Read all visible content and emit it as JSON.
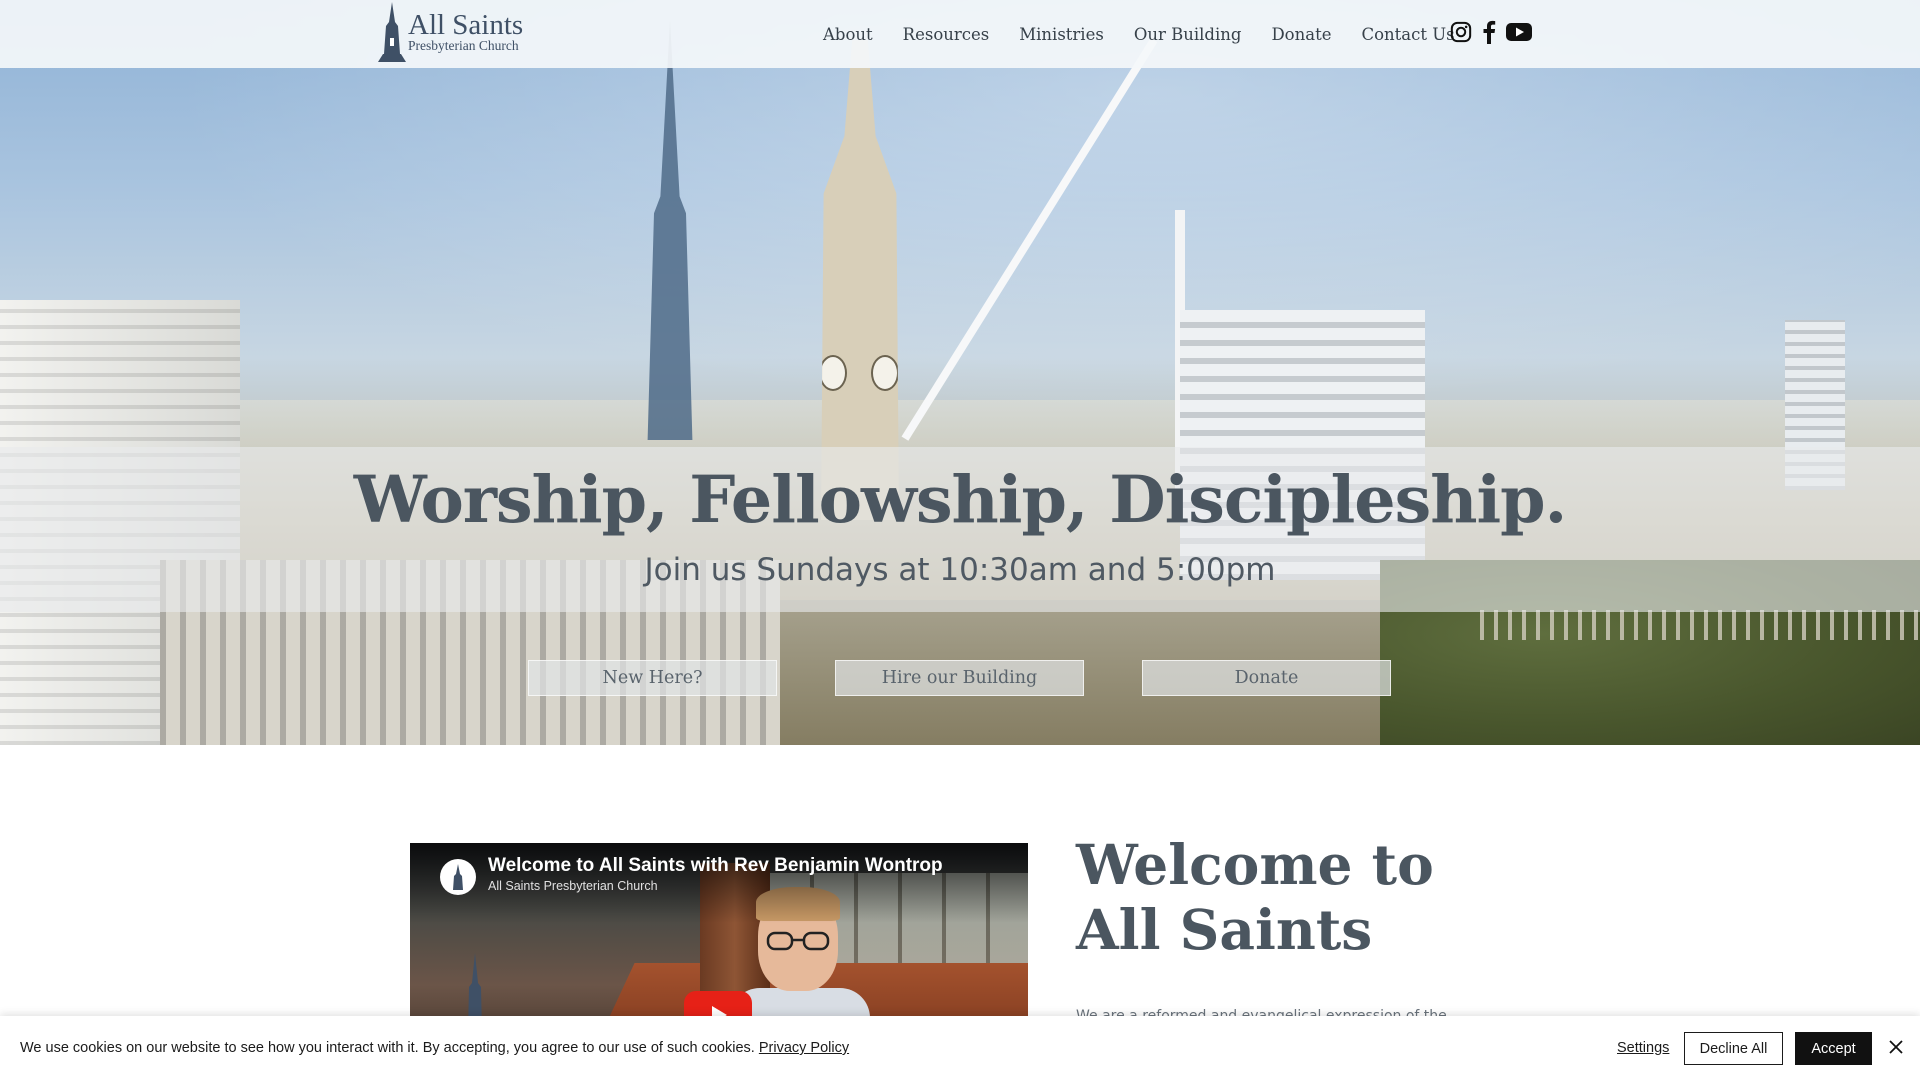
{
  "site": {
    "logo_title": "All Saints",
    "logo_subtitle": "Presbyterian Church"
  },
  "nav": {
    "items": [
      {
        "label": "About"
      },
      {
        "label": "Resources"
      },
      {
        "label": "Ministries"
      },
      {
        "label": "Our Building"
      },
      {
        "label": "Donate"
      },
      {
        "label": "Contact Us"
      }
    ]
  },
  "social": {
    "icons": [
      "instagram-icon",
      "facebook-icon",
      "youtube-icon"
    ]
  },
  "hero": {
    "title": "Worship, Fellowship, Discipleship.",
    "subtitle": "Join us Sundays at 10:30am and 5:00pm",
    "buttons": [
      {
        "label": "New Here?"
      },
      {
        "label": "Hire our Building"
      },
      {
        "label": "Donate"
      }
    ]
  },
  "video": {
    "title": "Welcome to All Saints with Rev Benjamin Wontrop",
    "channel": "All Saints Presbyterian Church"
  },
  "welcome": {
    "title_line1": "Welcome to",
    "title_line2": "All Saints",
    "body": "We are a reformed and evangelical expression of the"
  },
  "cookie": {
    "text": "We use cookies on our website to see how you interact with it. By accepting, you agree to our use of such cookies.",
    "link": "Privacy Policy",
    "settings": "Settings",
    "decline": "Decline All",
    "accept": "Accept"
  },
  "colors": {
    "heading": "#4b5660",
    "logo": "#3f5066",
    "youtube_red": "#e62117",
    "accept_bg": "#111111"
  }
}
